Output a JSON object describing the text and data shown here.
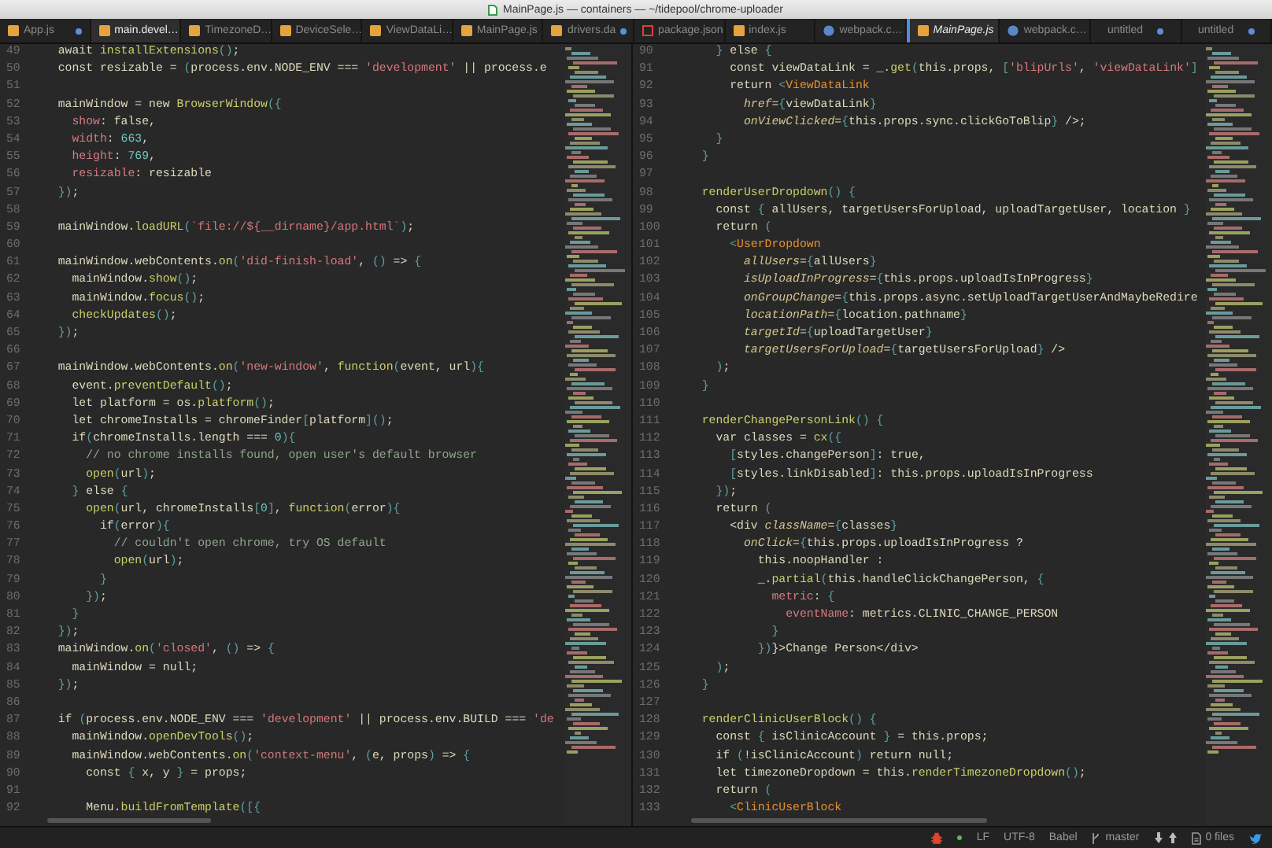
{
  "window": {
    "title": "MainPage.js — containers — ~/tidepool/chrome-uploader"
  },
  "tabs": [
    {
      "label": "App.js",
      "kind": "js",
      "selected": false,
      "focused": false,
      "pending": false,
      "modified": true
    },
    {
      "label": "main.devel…",
      "kind": "js",
      "selected": true,
      "focused": false,
      "pending": false,
      "modified": false
    },
    {
      "label": "TimezoneD…",
      "kind": "js",
      "selected": false,
      "focused": false,
      "pending": false,
      "modified": false
    },
    {
      "label": "DeviceSele…",
      "kind": "js",
      "selected": false,
      "focused": false,
      "pending": false,
      "modified": false
    },
    {
      "label": "ViewDataLi…",
      "kind": "js",
      "selected": false,
      "focused": false,
      "pending": false,
      "modified": false
    },
    {
      "label": "MainPage.js",
      "kind": "js",
      "selected": false,
      "focused": false,
      "pending": false,
      "modified": false
    },
    {
      "label": "drivers.da",
      "kind": "js",
      "selected": false,
      "focused": false,
      "pending": false,
      "modified": true
    },
    {
      "label": "package.json",
      "kind": "npm",
      "selected": false,
      "focused": false,
      "pending": false,
      "modified": false
    },
    {
      "label": "index.js",
      "kind": "js",
      "selected": false,
      "focused": false,
      "pending": false,
      "modified": false
    },
    {
      "label": "webpack.c…",
      "kind": "web",
      "selected": false,
      "focused": false,
      "pending": false,
      "modified": false
    },
    {
      "label": "MainPage.js",
      "kind": "js",
      "selected": true,
      "focused": true,
      "pending": true,
      "modified": false
    },
    {
      "label": "webpack.c…",
      "kind": "web",
      "selected": false,
      "focused": false,
      "pending": false,
      "modified": false
    },
    {
      "label": "untitled",
      "kind": "plain",
      "selected": false,
      "focused": false,
      "pending": false,
      "modified": true
    },
    {
      "label": "untitled",
      "kind": "plain",
      "selected": false,
      "focused": false,
      "pending": false,
      "modified": true
    }
  ],
  "panes": [
    {
      "lines": [
        {
          "number": "49",
          "tokens": [
            {
              "kind": "p",
              "text": "  await "
            },
            {
              "kind": "f",
              "text": "installExtensions"
            },
            {
              "kind": "x",
              "text": "()"
            },
            {
              "kind": "p",
              "text": ";"
            }
          ]
        },
        {
          "number": "50",
          "tokens": [
            {
              "kind": "p",
              "text": "  const resizable = "
            },
            {
              "kind": "x",
              "text": "("
            },
            {
              "kind": "p",
              "text": "process.env.NODE_ENV === "
            },
            {
              "kind": "s",
              "text": "'development'"
            },
            {
              "kind": "p",
              "text": " || process.e"
            }
          ]
        },
        {
          "number": "51"
        },
        {
          "number": "52",
          "tokens": [
            {
              "kind": "p",
              "text": "  mainWindow = new "
            },
            {
              "kind": "f",
              "text": "BrowserWindow"
            },
            {
              "kind": "x",
              "text": "({"
            }
          ]
        },
        {
          "number": "53",
          "tokens": [
            {
              "kind": "a",
              "text": "    show"
            },
            {
              "kind": "p",
              "text": ": false,"
            }
          ]
        },
        {
          "number": "54",
          "tokens": [
            {
              "kind": "a",
              "text": "    width"
            },
            {
              "kind": "p",
              "text": ": "
            },
            {
              "kind": "n",
              "text": "663"
            },
            {
              "kind": "p",
              "text": ","
            }
          ]
        },
        {
          "number": "55",
          "tokens": [
            {
              "kind": "a",
              "text": "    height"
            },
            {
              "kind": "p",
              "text": ": "
            },
            {
              "kind": "n",
              "text": "769"
            },
            {
              "kind": "p",
              "text": ","
            }
          ]
        },
        {
          "number": "56",
          "tokens": [
            {
              "kind": "a",
              "text": "    resizable"
            },
            {
              "kind": "p",
              "text": ": resizable"
            }
          ]
        },
        {
          "number": "57",
          "tokens": [
            {
              "kind": "x",
              "text": "  })"
            },
            {
              "kind": "p",
              "text": ";"
            }
          ]
        },
        {
          "number": "58"
        },
        {
          "number": "59",
          "tokens": [
            {
              "kind": "p",
              "text": "  mainWindow."
            },
            {
              "kind": "f",
              "text": "loadURL"
            },
            {
              "kind": "x",
              "text": "("
            },
            {
              "kind": "s",
              "text": "`file://${__dirname}/app.html`"
            },
            {
              "kind": "x",
              "text": ")"
            },
            {
              "kind": "p",
              "text": ";"
            }
          ]
        },
        {
          "number": "60"
        },
        {
          "number": "61",
          "tokens": [
            {
              "kind": "p",
              "text": "  mainWindow.webContents."
            },
            {
              "kind": "f",
              "text": "on"
            },
            {
              "kind": "x",
              "text": "("
            },
            {
              "kind": "s",
              "text": "'did-finish-load'"
            },
            {
              "kind": "p",
              "text": ", "
            },
            {
              "kind": "x",
              "text": "()"
            },
            {
              "kind": "p",
              "text": " => "
            },
            {
              "kind": "x",
              "text": "{"
            }
          ]
        },
        {
          "number": "62",
          "tokens": [
            {
              "kind": "p",
              "text": "    mainWindow."
            },
            {
              "kind": "f",
              "text": "show"
            },
            {
              "kind": "x",
              "text": "()"
            },
            {
              "kind": "p",
              "text": ";"
            }
          ]
        },
        {
          "number": "63",
          "tokens": [
            {
              "kind": "p",
              "text": "    mainWindow."
            },
            {
              "kind": "f",
              "text": "focus"
            },
            {
              "kind": "x",
              "text": "()"
            },
            {
              "kind": "p",
              "text": ";"
            }
          ]
        },
        {
          "number": "64",
          "tokens": [
            {
              "kind": "f",
              "text": "    checkUpdates"
            },
            {
              "kind": "x",
              "text": "()"
            },
            {
              "kind": "p",
              "text": ";"
            }
          ]
        },
        {
          "number": "65",
          "tokens": [
            {
              "kind": "x",
              "text": "  })"
            },
            {
              "kind": "p",
              "text": ";"
            }
          ]
        },
        {
          "number": "66"
        },
        {
          "number": "67",
          "tokens": [
            {
              "kind": "p",
              "text": "  mainWindow.webContents."
            },
            {
              "kind": "f",
              "text": "on"
            },
            {
              "kind": "x",
              "text": "("
            },
            {
              "kind": "s",
              "text": "'new-window'"
            },
            {
              "kind": "p",
              "text": ", "
            },
            {
              "kind": "f",
              "text": "function"
            },
            {
              "kind": "x",
              "text": "("
            },
            {
              "kind": "p",
              "text": "event, url"
            },
            {
              "kind": "x",
              "text": "){"
            }
          ]
        },
        {
          "number": "68",
          "tokens": [
            {
              "kind": "p",
              "text": "    event."
            },
            {
              "kind": "f",
              "text": "preventDefault"
            },
            {
              "kind": "x",
              "text": "()"
            },
            {
              "kind": "p",
              "text": ";"
            }
          ]
        },
        {
          "number": "69",
          "tokens": [
            {
              "kind": "p",
              "text": "    let platform = os."
            },
            {
              "kind": "f",
              "text": "platform"
            },
            {
              "kind": "x",
              "text": "()"
            },
            {
              "kind": "p",
              "text": ";"
            }
          ]
        },
        {
          "number": "70",
          "tokens": [
            {
              "kind": "p",
              "text": "    let chromeInstalls = chromeFinder"
            },
            {
              "kind": "x",
              "text": "["
            },
            {
              "kind": "p",
              "text": "platform"
            },
            {
              "kind": "x",
              "text": "]()"
            },
            {
              "kind": "p",
              "text": ";"
            }
          ]
        },
        {
          "number": "71",
          "tokens": [
            {
              "kind": "p",
              "text": "    if"
            },
            {
              "kind": "x",
              "text": "("
            },
            {
              "kind": "p",
              "text": "chromeInstalls.length === "
            },
            {
              "kind": "n",
              "text": "0"
            },
            {
              "kind": "x",
              "text": "){"
            }
          ]
        },
        {
          "number": "72",
          "tokens": [
            {
              "kind": "c",
              "text": "      // no chrome installs found, open user's default browser"
            }
          ]
        },
        {
          "number": "73",
          "tokens": [
            {
              "kind": "f",
              "text": "      open"
            },
            {
              "kind": "x",
              "text": "("
            },
            {
              "kind": "p",
              "text": "url"
            },
            {
              "kind": "x",
              "text": ")"
            },
            {
              "kind": "p",
              "text": ";"
            }
          ]
        },
        {
          "number": "74",
          "tokens": [
            {
              "kind": "x",
              "text": "    }"
            },
            {
              "kind": "p",
              "text": " else "
            },
            {
              "kind": "x",
              "text": "{"
            }
          ]
        },
        {
          "number": "75",
          "tokens": [
            {
              "kind": "f",
              "text": "      open"
            },
            {
              "kind": "x",
              "text": "("
            },
            {
              "kind": "p",
              "text": "url, chromeInstalls"
            },
            {
              "kind": "x",
              "text": "["
            },
            {
              "kind": "n",
              "text": "0"
            },
            {
              "kind": "x",
              "text": "]"
            },
            {
              "kind": "p",
              "text": ", "
            },
            {
              "kind": "f",
              "text": "function"
            },
            {
              "kind": "x",
              "text": "("
            },
            {
              "kind": "p",
              "text": "error"
            },
            {
              "kind": "x",
              "text": "){"
            }
          ]
        },
        {
          "number": "76",
          "tokens": [
            {
              "kind": "p",
              "text": "        if"
            },
            {
              "kind": "x",
              "text": "("
            },
            {
              "kind": "p",
              "text": "error"
            },
            {
              "kind": "x",
              "text": "){"
            }
          ]
        },
        {
          "number": "77",
          "tokens": [
            {
              "kind": "c",
              "text": "          // couldn't open chrome, try OS default"
            }
          ]
        },
        {
          "number": "78",
          "tokens": [
            {
              "kind": "f",
              "text": "          open"
            },
            {
              "kind": "x",
              "text": "("
            },
            {
              "kind": "p",
              "text": "url"
            },
            {
              "kind": "x",
              "text": ")"
            },
            {
              "kind": "p",
              "text": ";"
            }
          ]
        },
        {
          "number": "79",
          "tokens": [
            {
              "kind": "x",
              "text": "        }"
            }
          ]
        },
        {
          "number": "80",
          "tokens": [
            {
              "kind": "x",
              "text": "      })"
            },
            {
              "kind": "p",
              "text": ";"
            }
          ]
        },
        {
          "number": "81",
          "tokens": [
            {
              "kind": "x",
              "text": "    }"
            }
          ]
        },
        {
          "number": "82",
          "tokens": [
            {
              "kind": "x",
              "text": "  })"
            },
            {
              "kind": "p",
              "text": ";"
            }
          ]
        },
        {
          "number": "83",
          "tokens": [
            {
              "kind": "p",
              "text": "  mainWindow."
            },
            {
              "kind": "f",
              "text": "on"
            },
            {
              "kind": "x",
              "text": "("
            },
            {
              "kind": "s",
              "text": "'closed'"
            },
            {
              "kind": "p",
              "text": ", "
            },
            {
              "kind": "x",
              "text": "()"
            },
            {
              "kind": "p",
              "text": " => "
            },
            {
              "kind": "x",
              "text": "{"
            }
          ]
        },
        {
          "number": "84",
          "tokens": [
            {
              "kind": "p",
              "text": "    mainWindow = null;"
            }
          ]
        },
        {
          "number": "85",
          "tokens": [
            {
              "kind": "x",
              "text": "  })"
            },
            {
              "kind": "p",
              "text": ";"
            }
          ]
        },
        {
          "number": "86"
        },
        {
          "number": "87",
          "tokens": [
            {
              "kind": "p",
              "text": "  if "
            },
            {
              "kind": "x",
              "text": "("
            },
            {
              "kind": "p",
              "text": "process.env.NODE_ENV === "
            },
            {
              "kind": "s",
              "text": "'development'"
            },
            {
              "kind": "p",
              "text": " || process.env.BUILD === "
            },
            {
              "kind": "s",
              "text": "'de"
            }
          ]
        },
        {
          "number": "88",
          "tokens": [
            {
              "kind": "p",
              "text": "    mainWindow."
            },
            {
              "kind": "f",
              "text": "openDevTools"
            },
            {
              "kind": "x",
              "text": "()"
            },
            {
              "kind": "p",
              "text": ";"
            }
          ]
        },
        {
          "number": "89",
          "tokens": [
            {
              "kind": "p",
              "text": "    mainWindow.webContents."
            },
            {
              "kind": "f",
              "text": "on"
            },
            {
              "kind": "x",
              "text": "("
            },
            {
              "kind": "s",
              "text": "'context-menu'"
            },
            {
              "kind": "p",
              "text": ", "
            },
            {
              "kind": "x",
              "text": "("
            },
            {
              "kind": "p",
              "text": "e, props"
            },
            {
              "kind": "x",
              "text": ")"
            },
            {
              "kind": "p",
              "text": " => "
            },
            {
              "kind": "x",
              "text": "{"
            }
          ]
        },
        {
          "number": "90",
          "tokens": [
            {
              "kind": "p",
              "text": "      const "
            },
            {
              "kind": "x",
              "text": "{"
            },
            {
              "kind": "p",
              "text": " x, y "
            },
            {
              "kind": "x",
              "text": "}"
            },
            {
              "kind": "p",
              "text": " = props;"
            }
          ]
        },
        {
          "number": "91"
        },
        {
          "number": "92",
          "tokens": [
            {
              "kind": "p",
              "text": "      Menu."
            },
            {
              "kind": "f",
              "text": "buildFromTemplate"
            },
            {
              "kind": "x",
              "text": "([{"
            }
          ]
        }
      ]
    },
    {
      "lines": [
        {
          "number": "90",
          "tokens": [
            {
              "kind": "x",
              "text": "    }"
            },
            {
              "kind": "p",
              "text": " else "
            },
            {
              "kind": "x",
              "text": "{"
            }
          ]
        },
        {
          "number": "91",
          "tokens": [
            {
              "kind": "p",
              "text": "      const viewDataLink = _."
            },
            {
              "kind": "f",
              "text": "get"
            },
            {
              "kind": "x",
              "text": "("
            },
            {
              "kind": "p",
              "text": "this.props, "
            },
            {
              "kind": "x",
              "text": "["
            },
            {
              "kind": "s",
              "text": "'blipUrls'"
            },
            {
              "kind": "p",
              "text": ", "
            },
            {
              "kind": "s",
              "text": "'viewDataLink'"
            },
            {
              "kind": "x",
              "text": "]"
            }
          ]
        },
        {
          "number": "92",
          "tokens": [
            {
              "kind": "p",
              "text": "      return "
            },
            {
              "kind": "x",
              "text": "<"
            },
            {
              "kind": "t",
              "text": "ViewDataLink"
            }
          ]
        },
        {
          "number": "93",
          "tokens": [
            {
              "kind": "j",
              "text": "        href"
            },
            {
              "kind": "p",
              "text": "="
            },
            {
              "kind": "x",
              "text": "{"
            },
            {
              "kind": "p",
              "text": "viewDataLink"
            },
            {
              "kind": "x",
              "text": "}"
            }
          ]
        },
        {
          "number": "94",
          "tokens": [
            {
              "kind": "j",
              "text": "        onViewClicked"
            },
            {
              "kind": "p",
              "text": "="
            },
            {
              "kind": "x",
              "text": "{"
            },
            {
              "kind": "p",
              "text": "this.props.sync.clickGoToBlip"
            },
            {
              "kind": "x",
              "text": "}"
            },
            {
              "kind": "p",
              "text": " />;"
            }
          ]
        },
        {
          "number": "95",
          "tokens": [
            {
              "kind": "x",
              "text": "    }"
            }
          ]
        },
        {
          "number": "96",
          "tokens": [
            {
              "kind": "x",
              "text": "  }"
            }
          ]
        },
        {
          "number": "97"
        },
        {
          "number": "98",
          "tokens": [
            {
              "kind": "f",
              "text": "  renderUserDropdown"
            },
            {
              "kind": "x",
              "text": "() {"
            }
          ]
        },
        {
          "number": "99",
          "tokens": [
            {
              "kind": "p",
              "text": "    const "
            },
            {
              "kind": "x",
              "text": "{"
            },
            {
              "kind": "p",
              "text": " allUsers, targetUsersForUpload, uploadTargetUser, location "
            },
            {
              "kind": "x",
              "text": "}"
            }
          ]
        },
        {
          "number": "100",
          "tokens": [
            {
              "kind": "p",
              "text": "    return "
            },
            {
              "kind": "x",
              "text": "("
            }
          ]
        },
        {
          "number": "101",
          "tokens": [
            {
              "kind": "x",
              "text": "      <"
            },
            {
              "kind": "t",
              "text": "UserDropdown"
            }
          ]
        },
        {
          "number": "102",
          "tokens": [
            {
              "kind": "j",
              "text": "        allUsers"
            },
            {
              "kind": "p",
              "text": "="
            },
            {
              "kind": "x",
              "text": "{"
            },
            {
              "kind": "p",
              "text": "allUsers"
            },
            {
              "kind": "x",
              "text": "}"
            }
          ]
        },
        {
          "number": "103",
          "tokens": [
            {
              "kind": "j",
              "text": "        isUploadInProgress"
            },
            {
              "kind": "p",
              "text": "="
            },
            {
              "kind": "x",
              "text": "{"
            },
            {
              "kind": "p",
              "text": "this.props.uploadIsInProgress"
            },
            {
              "kind": "x",
              "text": "}"
            }
          ]
        },
        {
          "number": "104",
          "tokens": [
            {
              "kind": "j",
              "text": "        onGroupChange"
            },
            {
              "kind": "p",
              "text": "="
            },
            {
              "kind": "x",
              "text": "{"
            },
            {
              "kind": "p",
              "text": "this.props.async.setUploadTargetUserAndMaybeRedire"
            }
          ]
        },
        {
          "number": "105",
          "tokens": [
            {
              "kind": "j",
              "text": "        locationPath"
            },
            {
              "kind": "p",
              "text": "="
            },
            {
              "kind": "x",
              "text": "{"
            },
            {
              "kind": "p",
              "text": "location.pathname"
            },
            {
              "kind": "x",
              "text": "}"
            }
          ]
        },
        {
          "number": "106",
          "tokens": [
            {
              "kind": "j",
              "text": "        targetId"
            },
            {
              "kind": "p",
              "text": "="
            },
            {
              "kind": "x",
              "text": "{"
            },
            {
              "kind": "p",
              "text": "uploadTargetUser"
            },
            {
              "kind": "x",
              "text": "}"
            }
          ]
        },
        {
          "number": "107",
          "tokens": [
            {
              "kind": "j",
              "text": "        targetUsersForUpload"
            },
            {
              "kind": "p",
              "text": "="
            },
            {
              "kind": "x",
              "text": "{"
            },
            {
              "kind": "p",
              "text": "targetUsersForUpload"
            },
            {
              "kind": "x",
              "text": "}"
            },
            {
              "kind": "p",
              "text": " />"
            }
          ]
        },
        {
          "number": "108",
          "tokens": [
            {
              "kind": "x",
              "text": "    )"
            },
            {
              "kind": "p",
              "text": ";"
            }
          ]
        },
        {
          "number": "109",
          "tokens": [
            {
              "kind": "x",
              "text": "  }"
            }
          ]
        },
        {
          "number": "110"
        },
        {
          "number": "111",
          "tokens": [
            {
              "kind": "f",
              "text": "  renderChangePersonLink"
            },
            {
              "kind": "x",
              "text": "() {"
            }
          ]
        },
        {
          "number": "112",
          "tokens": [
            {
              "kind": "p",
              "text": "    var classes = "
            },
            {
              "kind": "f",
              "text": "cx"
            },
            {
              "kind": "x",
              "text": "({"
            }
          ]
        },
        {
          "number": "113",
          "tokens": [
            {
              "kind": "x",
              "text": "      ["
            },
            {
              "kind": "p",
              "text": "styles.changePerson"
            },
            {
              "kind": "x",
              "text": "]"
            },
            {
              "kind": "p",
              "text": ": true,"
            }
          ]
        },
        {
          "number": "114",
          "tokens": [
            {
              "kind": "x",
              "text": "      ["
            },
            {
              "kind": "p",
              "text": "styles.linkDisabled"
            },
            {
              "kind": "x",
              "text": "]"
            },
            {
              "kind": "p",
              "text": ": this.props.uploadIsInProgress"
            }
          ]
        },
        {
          "number": "115",
          "tokens": [
            {
              "kind": "x",
              "text": "    })"
            },
            {
              "kind": "p",
              "text": ";"
            }
          ]
        },
        {
          "number": "116",
          "tokens": [
            {
              "kind": "p",
              "text": "    return "
            },
            {
              "kind": "x",
              "text": "("
            }
          ]
        },
        {
          "number": "117",
          "tokens": [
            {
              "kind": "p",
              "text": "      <div "
            },
            {
              "kind": "j",
              "text": "className"
            },
            {
              "kind": "p",
              "text": "="
            },
            {
              "kind": "x",
              "text": "{"
            },
            {
              "kind": "p",
              "text": "classes"
            },
            {
              "kind": "x",
              "text": "}"
            }
          ]
        },
        {
          "number": "118",
          "tokens": [
            {
              "kind": "j",
              "text": "        onClick"
            },
            {
              "kind": "p",
              "text": "="
            },
            {
              "kind": "x",
              "text": "{"
            },
            {
              "kind": "p",
              "text": "this.props.uploadIsInProgress ?"
            }
          ]
        },
        {
          "number": "119",
          "tokens": [
            {
              "kind": "p",
              "text": "          this.noopHandler :"
            }
          ]
        },
        {
          "number": "120",
          "tokens": [
            {
              "kind": "p",
              "text": "          _."
            },
            {
              "kind": "f",
              "text": "partial"
            },
            {
              "kind": "x",
              "text": "("
            },
            {
              "kind": "p",
              "text": "this.handleClickChangePerson, "
            },
            {
              "kind": "x",
              "text": "{"
            }
          ]
        },
        {
          "number": "121",
          "tokens": [
            {
              "kind": "a",
              "text": "            metric"
            },
            {
              "kind": "p",
              "text": ": "
            },
            {
              "kind": "x",
              "text": "{"
            }
          ]
        },
        {
          "number": "122",
          "tokens": [
            {
              "kind": "a",
              "text": "              eventName"
            },
            {
              "kind": "p",
              "text": ": metrics.CLINIC_CHANGE_PERSON"
            }
          ]
        },
        {
          "number": "123",
          "tokens": [
            {
              "kind": "x",
              "text": "            }"
            }
          ]
        },
        {
          "number": "124",
          "tokens": [
            {
              "kind": "x",
              "text": "          })"
            },
            {
              "kind": "p",
              "text": "}>Change Person</div>"
            }
          ]
        },
        {
          "number": "125",
          "tokens": [
            {
              "kind": "x",
              "text": "    )"
            },
            {
              "kind": "p",
              "text": ";"
            }
          ]
        },
        {
          "number": "126",
          "tokens": [
            {
              "kind": "x",
              "text": "  }"
            }
          ]
        },
        {
          "number": "127"
        },
        {
          "number": "128",
          "tokens": [
            {
              "kind": "f",
              "text": "  renderClinicUserBlock"
            },
            {
              "kind": "x",
              "text": "() {"
            }
          ]
        },
        {
          "number": "129",
          "tokens": [
            {
              "kind": "p",
              "text": "    const "
            },
            {
              "kind": "x",
              "text": "{"
            },
            {
              "kind": "p",
              "text": " isClinicAccount "
            },
            {
              "kind": "x",
              "text": "}"
            },
            {
              "kind": "p",
              "text": " = this.props;"
            }
          ]
        },
        {
          "number": "130",
          "tokens": [
            {
              "kind": "p",
              "text": "    if "
            },
            {
              "kind": "x",
              "text": "("
            },
            {
              "kind": "p",
              "text": "!isClinicAccount"
            },
            {
              "kind": "x",
              "text": ")"
            },
            {
              "kind": "p",
              "text": " return null;"
            }
          ]
        },
        {
          "number": "131",
          "tokens": [
            {
              "kind": "p",
              "text": "    let timezoneDropdown = this."
            },
            {
              "kind": "f",
              "text": "renderTimezoneDropdown"
            },
            {
              "kind": "x",
              "text": "()"
            },
            {
              "kind": "p",
              "text": ";"
            }
          ]
        },
        {
          "number": "132",
          "tokens": [
            {
              "kind": "p",
              "text": "    return "
            },
            {
              "kind": "x",
              "text": "("
            }
          ]
        },
        {
          "number": "133",
          "tokens": [
            {
              "kind": "x",
              "text": "      <"
            },
            {
              "kind": "t",
              "text": "ClinicUserBlock"
            }
          ]
        }
      ]
    }
  ],
  "status_bar": {
    "line_ending": "LF",
    "encoding": "UTF-8",
    "grammar": "Babel",
    "branch": "master",
    "changed_files": "0 files"
  }
}
